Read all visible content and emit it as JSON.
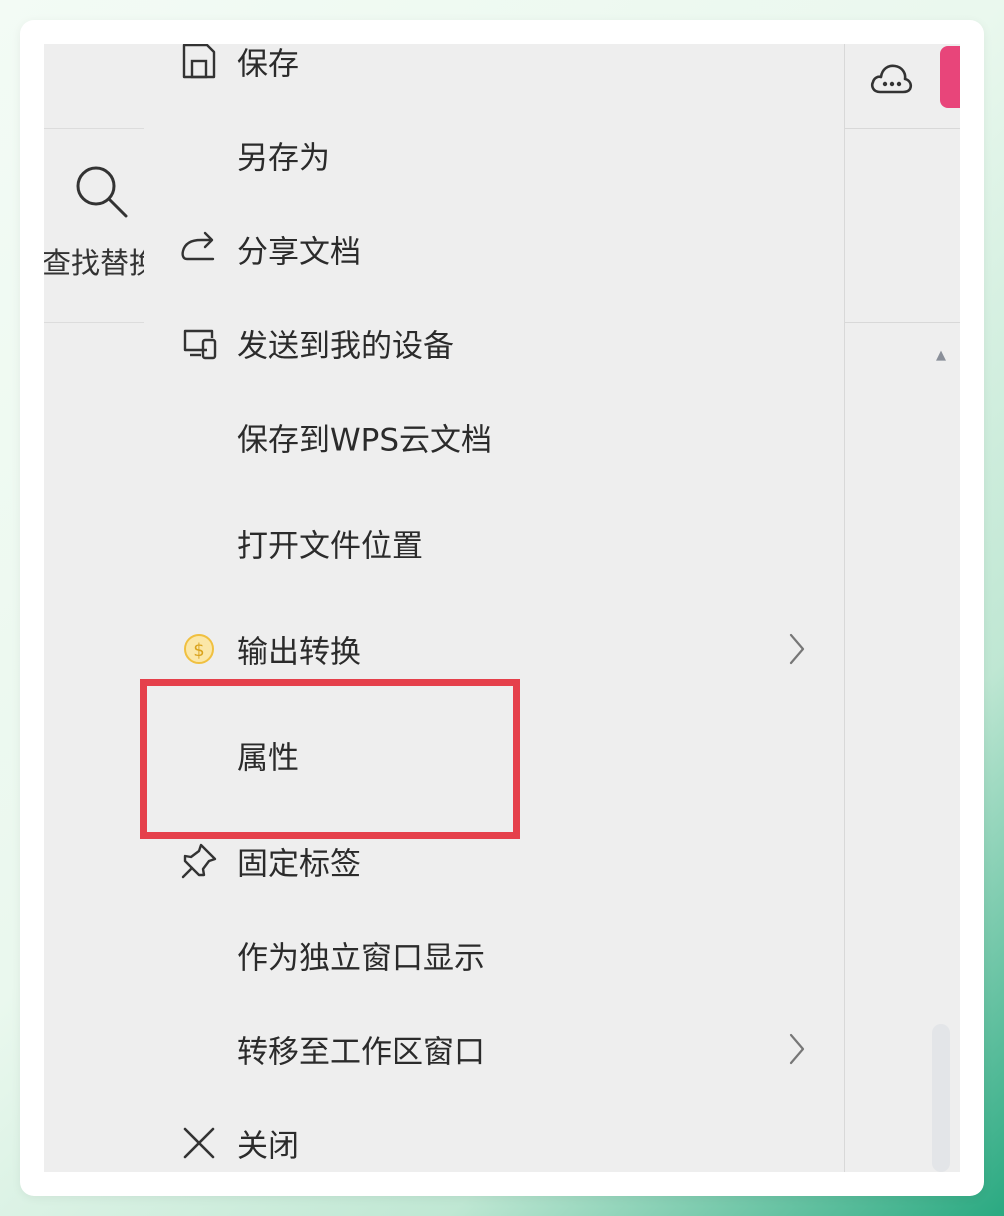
{
  "left_panel": {
    "search_label": "查找替换"
  },
  "menu": {
    "items": [
      {
        "id": "save",
        "label": "保存",
        "icon": "save-icon",
        "has_submenu": false
      },
      {
        "id": "save-as",
        "label": "另存为",
        "icon": "",
        "has_submenu": false
      },
      {
        "id": "share",
        "label": "分享文档",
        "icon": "share-icon",
        "has_submenu": false
      },
      {
        "id": "send-device",
        "label": "发送到我的设备",
        "icon": "device-icon",
        "has_submenu": false
      },
      {
        "id": "save-cloud",
        "label": "保存到WPS云文档",
        "icon": "",
        "has_submenu": false
      },
      {
        "id": "open-location",
        "label": "打开文件位置",
        "icon": "",
        "has_submenu": false
      },
      {
        "id": "export",
        "label": "输出转换",
        "icon": "coin-icon",
        "has_submenu": true
      },
      {
        "id": "properties",
        "label": "属性",
        "icon": "",
        "has_submenu": false,
        "highlighted": true
      },
      {
        "id": "pin-tab",
        "label": "固定标签",
        "icon": "pin-icon",
        "has_submenu": false
      },
      {
        "id": "separate-window",
        "label": "作为独立窗口显示",
        "icon": "",
        "has_submenu": false
      },
      {
        "id": "move-workspace",
        "label": "转移至工作区窗口",
        "icon": "",
        "has_submenu": true
      },
      {
        "id": "close",
        "label": "关闭",
        "icon": "close-icon",
        "has_submenu": false
      }
    ]
  },
  "colors": {
    "highlight_border": "#e5404b",
    "avatar": "#e8457a",
    "coin": "#f0c040"
  }
}
